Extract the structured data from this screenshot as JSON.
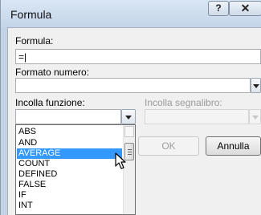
{
  "window": {
    "title": "Formula",
    "help_label": "?",
    "close_label": "✕"
  },
  "formula": {
    "label": "Formula:",
    "value": "=|"
  },
  "number_format": {
    "label": "Formato numero:",
    "value": ""
  },
  "paste_function": {
    "label": "Incolla funzione:",
    "value": ""
  },
  "paste_bookmark": {
    "label": "Incolla segnalibro:",
    "value": ""
  },
  "buttons": {
    "ok": "OK",
    "cancel": "Annulla"
  },
  "function_list": {
    "selected": "AVERAGE",
    "items": [
      "ABS",
      "AND",
      "AVERAGE",
      "COUNT",
      "DEFINED",
      "FALSE",
      "IF",
      "INT"
    ]
  },
  "icons": {
    "dropdown": "chevron-down-icon",
    "cursor": "mouse-pointer-icon"
  }
}
